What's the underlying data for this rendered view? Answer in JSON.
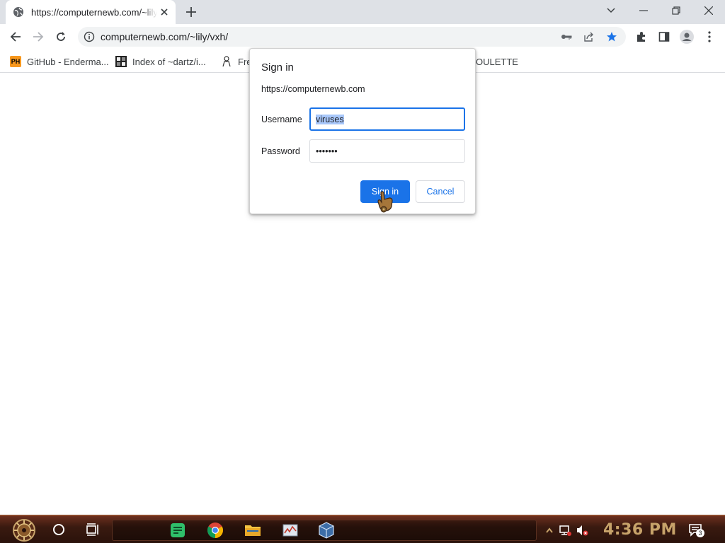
{
  "browser": {
    "tab": {
      "title": "https://computernewb.com/~lily/vxh/"
    },
    "url": "computernewb.com/~lily/vxh/"
  },
  "bookmarks": [
    {
      "label": "GitHub - Enderma...",
      "icon": "ph-icon"
    },
    {
      "label": "Index of ~dartz/i...",
      "icon": "index-icon"
    },
    {
      "label": "Fre",
      "icon": "figure-icon"
    },
    {
      "label": "OULETTE",
      "icon": ""
    }
  ],
  "dialog": {
    "title": "Sign in",
    "origin": "https://computernewb.com",
    "username_label": "Username",
    "username_value": "viruses",
    "password_label": "Password",
    "password_value": "•••••••",
    "sign_in_label": "Sign in",
    "cancel_label": "Cancel"
  },
  "taskbar": {
    "clock": "4:36 PM",
    "notification_count": "3",
    "apps": [
      "notes-icon",
      "chrome-icon",
      "file-explorer-icon",
      "task-manager-icon",
      "virtualbox-icon"
    ]
  },
  "colors": {
    "accent": "#1a73e8",
    "taskbar": "#3a1a10",
    "clock": "#c7a36a"
  }
}
